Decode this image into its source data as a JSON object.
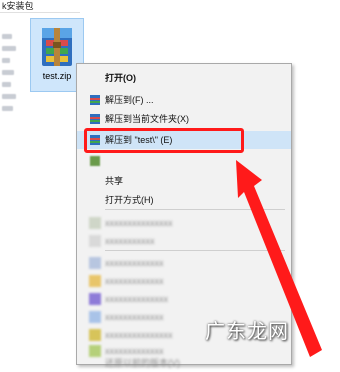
{
  "window": {
    "title": "k安装包"
  },
  "file": {
    "name": "test.zip",
    "icon": "winrar-archive-icon"
  },
  "context_menu": {
    "open": "打开(O)",
    "extract_to": "解压到(F) ...",
    "extract_here": "解压到当前文件夹(X)",
    "extract_to_folder": "解压到 \"test\\\" (E)",
    "share": "共享",
    "open_with": "打开方式(H)",
    "hidden_items": [
      "xxxxxxxxxxxxxxx",
      "xxxxxxxxxxx",
      "xxxxxxxxxxxxx",
      "xxxxxxxxxxxxx",
      "xxxxxxxxxxxxxx",
      "xxxxxxxxxxxxx",
      "xxxxxxxxxxxxxxx",
      "xxxxxxxxxxxxx",
      "还原以前的版本(V)"
    ]
  },
  "highlight_color": "#ff1a1a",
  "watermark": "广东龙网"
}
